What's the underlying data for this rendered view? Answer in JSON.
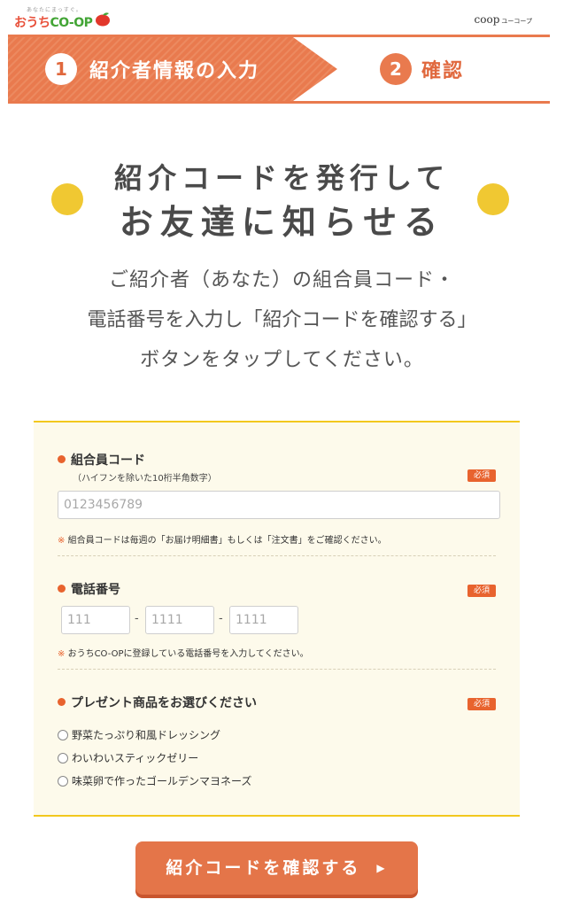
{
  "header": {
    "logo_tagline": "あなたにまっすぐ。",
    "logo_part1": "おうち",
    "logo_part2": "CO-OP",
    "coop_brand": "coop",
    "coop_sub": "ユーコープ"
  },
  "steps": [
    {
      "number": "1",
      "label": "紹介者情報の入力"
    },
    {
      "number": "2",
      "label": "確認"
    }
  ],
  "headline": {
    "line1": "紹介コードを発行して",
    "line2": "お友達に知らせる"
  },
  "description": {
    "line1": "ご紹介者（あなた）の組合員コード・",
    "line2": "電話番号を入力し「紹介コードを確認する」",
    "line3": "ボタンをタップしてください。"
  },
  "form": {
    "member_code": {
      "title": "組合員コード",
      "subtitle": "（ハイフンを除いた10桁半角数字）",
      "required": "必須",
      "placeholder": "0123456789",
      "note_mark": "※",
      "note": "組合員コードは毎週の「お届け明細書」もしくは「注文書」をご確認ください。"
    },
    "phone": {
      "title": "電話番号",
      "required": "必須",
      "placeholders": [
        "111",
        "1111",
        "1111"
      ],
      "separator": "-",
      "note_mark": "※",
      "note": "おうちCO-OPに登録している電話番号を入力してください。"
    },
    "present": {
      "title": "プレゼント商品をお選びください",
      "required": "必須",
      "options": [
        "野菜たっぷり和風ドレッシング",
        "わいわいスティックゼリー",
        "味菜卵で作ったゴールデンマヨネーズ"
      ]
    }
  },
  "submit_label": "紹介コードを確認する",
  "colors": {
    "accent": "#e97a4e",
    "yellow": "#f0c832",
    "panel_bg": "#fdfaeb"
  }
}
